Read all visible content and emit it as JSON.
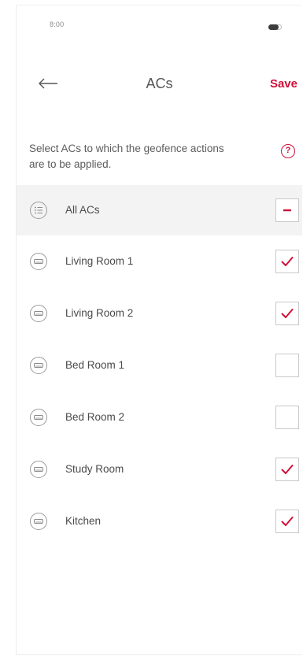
{
  "status_bar": {
    "time": "8:00"
  },
  "header": {
    "title": "ACs",
    "save_label": "Save"
  },
  "description": "Select ACs to which the geofence actions are to be applied.",
  "colors": {
    "accent": "#d0103a",
    "selected_row_bg": "#f3f3f4"
  },
  "all_acs": {
    "label": "All ACs",
    "state": "indeterminate",
    "icon": "list-icon"
  },
  "acs": [
    {
      "label": "Living Room 1",
      "checked": true,
      "icon": "air-conditioner-icon"
    },
    {
      "label": "Living Room 2",
      "checked": true,
      "icon": "air-conditioner-icon"
    },
    {
      "label": "Bed Room 1",
      "checked": false,
      "icon": "air-conditioner-icon"
    },
    {
      "label": "Bed Room 2",
      "checked": false,
      "icon": "air-conditioner-icon"
    },
    {
      "label": "Study Room",
      "checked": true,
      "icon": "air-conditioner-icon"
    },
    {
      "label": "Kitchen",
      "checked": true,
      "icon": "air-conditioner-icon"
    }
  ]
}
